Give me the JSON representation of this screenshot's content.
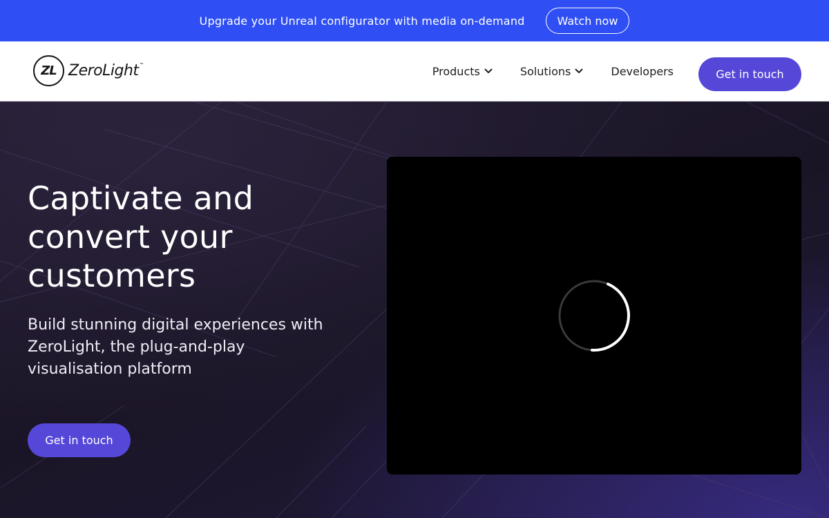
{
  "announcement": {
    "text": "Upgrade your Unreal configurator with media on-demand",
    "button_label": "Watch now"
  },
  "brand": {
    "mark": "ZL",
    "name": "ZeroLight",
    "trademark": "™"
  },
  "nav": {
    "items": [
      {
        "label": "Products",
        "dropdown": true
      },
      {
        "label": "Solutions",
        "dropdown": true
      },
      {
        "label": "Developers",
        "dropdown": false
      }
    ],
    "cta_label": "Get in touch"
  },
  "hero": {
    "title": "Captivate and convert your customers",
    "subtitle": "Build stunning digital experiences with ZeroLight, the plug-and-play visualisation platform",
    "cta_label": "Get in touch"
  },
  "video": {
    "state": "loading",
    "spinner_icon": "loading-spinner-icon"
  },
  "colors": {
    "announcement_bg": "#2f4ff5",
    "accent": "#5547d8",
    "hero_bg": "#1c1628",
    "video_bg": "#000000"
  }
}
